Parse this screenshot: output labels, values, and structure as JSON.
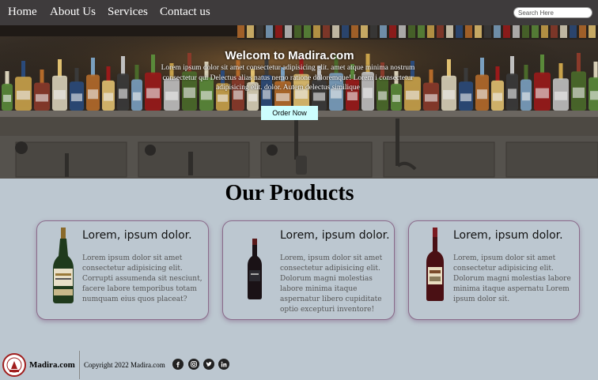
{
  "nav": {
    "items": [
      {
        "label": "Home"
      },
      {
        "label": "About Us"
      },
      {
        "label": "Services"
      },
      {
        "label": "Contact us"
      }
    ],
    "search_placeholder": "Search Here"
  },
  "hero": {
    "title": "Welcom to Madira.com",
    "text": "Lorem ipsum dolor sit amet consectetur adipisicing elit. amet atque minima nostrum consectetur qui Delectus alias natus nemo ratione doloremque! Lorem i consectetur adipisicing elit. dolor. Autem delectus similique",
    "button_label": "Order Now"
  },
  "products": {
    "title": "Our Products",
    "cards": [
      {
        "title": "Lorem, ipsum dolor.",
        "text": "Lorem ipsum dolor sit amet consectetur adipisicing elit. Corrupti assumenda sit nesciunt, facere labore temporibus totam numquam eius quos placeat?"
      },
      {
        "title": "Lorem, ipsum dolor.",
        "text": "Lorem, ipsum dolor sit amet consectetur adipisicing elit. Dolorum magni molestias labore minima itaque aspernatur libero cupiditate optio excepturi inventore!"
      },
      {
        "title": "Lorem, ipsum dolor.",
        "text": "Lorem, ipsum dolor sit amet consectetur adipisicing elit. Dolorum magni molestias labore minima itaque aspernatu Lorem ipsum dolor sit."
      }
    ]
  },
  "footer": {
    "brand": "Madira.com",
    "copyright": "Copyright 2022 Madira.com",
    "social_icons": [
      "facebook-icon",
      "instagram-icon",
      "twitter-icon",
      "linkedin-icon"
    ]
  },
  "colors": {
    "nav_bg": "#3e3b3c",
    "page_bg": "#bcc7d0",
    "button_bg": "#ccfefe",
    "card_border": "#8a6a8a"
  }
}
